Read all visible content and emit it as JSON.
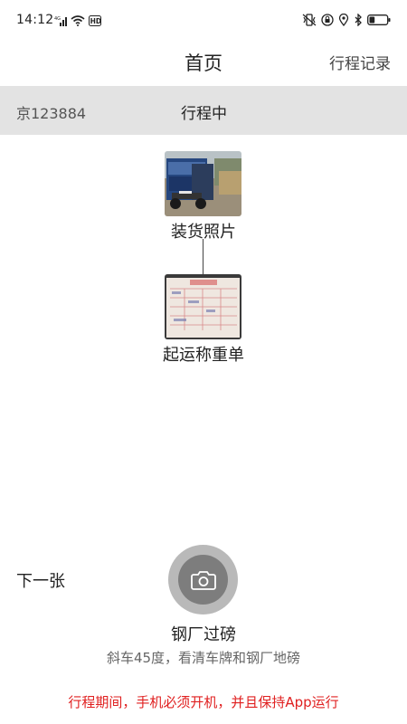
{
  "status_bar": {
    "time": "14:12",
    "network": "4G",
    "wifi_badge": "HD",
    "icons": [
      "signal-icon",
      "wifi-icon",
      "hd-icon",
      "vibrate-icon",
      "lock-rotation-icon",
      "location-icon",
      "bluetooth-icon",
      "battery-icon"
    ],
    "battery_level": 0.3
  },
  "header": {
    "title": "首页",
    "action_label": "行程记录"
  },
  "trip": {
    "plate": "京123884",
    "status": "行程中"
  },
  "steps": [
    {
      "label": "装货照片",
      "image": "truck-photo"
    },
    {
      "label": "起运称重单",
      "image": "weigh-ticket-photo"
    }
  ],
  "bottom": {
    "next_label": "下一张",
    "capture_title": "钢厂过磅",
    "capture_hint": "斜车45度，看清车牌和钢厂地磅",
    "warning": "行程期间，手机必须开机，并且保持App运行"
  },
  "colors": {
    "trip_bar_bg": "#e3e3e3",
    "warning_text": "#e02020",
    "camera_outer": "#b9b9b9",
    "camera_inner": "#7d7d7d"
  }
}
